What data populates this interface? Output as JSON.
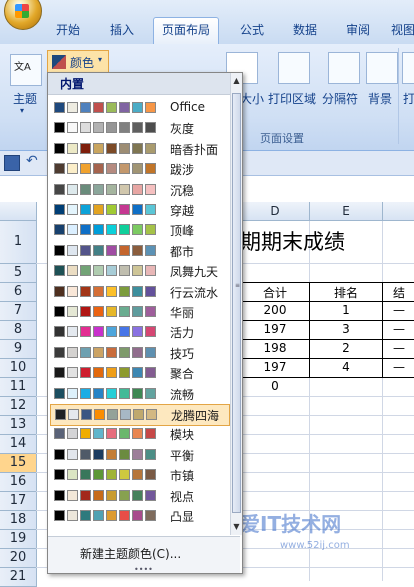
{
  "ribbon_tabs": [
    "开始",
    "插入",
    "页面布局",
    "公式",
    "数据",
    "审阅",
    "视图"
  ],
  "active_tab": "页面布局",
  "ribbon": {
    "theme_label": "主题",
    "colors_label": "颜色",
    "size_label": "大小",
    "print_area_label": "打印区域",
    "breaks_label": "分隔符",
    "background_label": "背景",
    "print_titles_label": "打",
    "group_label": "页面设置"
  },
  "dropdown": {
    "header": "内置",
    "new_theme": "新建主题颜色(C)...",
    "themes": [
      {
        "name": "Office",
        "colors": [
          "#1f497d",
          "#eeece1",
          "#4f81bd",
          "#c0504d",
          "#9bbb59",
          "#8064a2",
          "#4bacc6",
          "#f79646"
        ]
      },
      {
        "name": "灰度",
        "colors": [
          "#000000",
          "#f8f8f8",
          "#dddddd",
          "#b2b2b2",
          "#969696",
          "#808080",
          "#5f5f5f",
          "#4d4d4d"
        ]
      },
      {
        "name": "暗香扑面",
        "colors": [
          "#000000",
          "#ece9c6",
          "#7e1e0b",
          "#c9a55f",
          "#7c4a27",
          "#9d8d74",
          "#7f7652",
          "#a99b6e"
        ]
      },
      {
        "name": "跋涉",
        "colors": [
          "#4e3b30",
          "#fbeec9",
          "#f0a22e",
          "#a5644e",
          "#b58b80",
          "#c3986d",
          "#a19574",
          "#c17529"
        ]
      },
      {
        "name": "沉稳",
        "colors": [
          "#464646",
          "#dde9ec",
          "#6a8c7c",
          "#8ba69b",
          "#a5b59f",
          "#d1c7ad",
          "#e7a6a3",
          "#f5c0c0"
        ]
      },
      {
        "name": "穿越",
        "colors": [
          "#003e75",
          "#e3f4fc",
          "#0da2d8",
          "#e2a321",
          "#a0ca33",
          "#c53891",
          "#0f6fc6",
          "#5bc6d6"
        ]
      },
      {
        "name": "顶峰",
        "colors": [
          "#17406d",
          "#dbefff",
          "#0f6fc6",
          "#009dd9",
          "#0bd0d9",
          "#10cf9b",
          "#7cca62",
          "#a5c249"
        ]
      },
      {
        "name": "都市",
        "colors": [
          "#000000",
          "#dee6ef",
          "#53548a",
          "#438086",
          "#a04da3",
          "#c4652d",
          "#8b5d3d",
          "#5c92b5"
        ]
      },
      {
        "name": "凤舞九天",
        "colors": [
          "#1e5155",
          "#ebddc3",
          "#72a376",
          "#b0ccb0",
          "#a8cdd7",
          "#c0beaf",
          "#cec597",
          "#e8b7b7"
        ]
      },
      {
        "name": "行云流水",
        "colors": [
          "#4e2f1f",
          "#f9e7d8",
          "#a23517",
          "#d46f36",
          "#fcc02a",
          "#7c9c3c",
          "#3d8f9d",
          "#63519b"
        ]
      },
      {
        "name": "华丽",
        "colors": [
          "#000000",
          "#e5e8d5",
          "#b01513",
          "#ea6312",
          "#e6b729",
          "#6aac90",
          "#5f9c9d",
          "#9e5e9b"
        ]
      },
      {
        "name": "活力",
        "colors": [
          "#323232",
          "#e4e9ef",
          "#e32d91",
          "#c830cc",
          "#4ea6dc",
          "#4775e7",
          "#8971e1",
          "#d54773"
        ]
      },
      {
        "name": "技巧",
        "colors": [
          "#3b3b3b",
          "#d4d2d0",
          "#6ea0b0",
          "#cca364",
          "#c96c3c",
          "#7e9a6b",
          "#916d8d",
          "#5e90b0"
        ]
      },
      {
        "name": "聚合",
        "colors": [
          "#1a1a1a",
          "#e2e2e2",
          "#ce1f2f",
          "#e2690c",
          "#ef9e18",
          "#8d9b2d",
          "#3d87b2",
          "#835c91"
        ]
      },
      {
        "name": "流畅",
        "colors": [
          "#1c4e60",
          "#ddf1fb",
          "#1cade4",
          "#2683c6",
          "#27ced7",
          "#42ba97",
          "#3e8853",
          "#62a39f"
        ]
      },
      {
        "name": "龙腾四海",
        "colors": [
          "#1f2123",
          "#e4e9ee",
          "#3a5683",
          "#fa8d00",
          "#93a299",
          "#a7b8c5",
          "#c0a96d",
          "#d3b882"
        ]
      },
      {
        "name": "模块",
        "colors": [
          "#5a6378",
          "#d4d4d6",
          "#f0ad00",
          "#60b5cc",
          "#e66c7d",
          "#6bb76d",
          "#e88651",
          "#c64847"
        ]
      },
      {
        "name": "平衡",
        "colors": [
          "#000000",
          "#e2e6ec",
          "#4f5a68",
          "#1b3b5f",
          "#c47d36",
          "#6b8b3f",
          "#9d7e99",
          "#4c8e86"
        ]
      },
      {
        "name": "市镇",
        "colors": [
          "#000000",
          "#dbe5c3",
          "#38775b",
          "#5d9735",
          "#a0b435",
          "#cec93e",
          "#b6763b",
          "#7a5a45"
        ]
      },
      {
        "name": "视点",
        "colors": [
          "#000000",
          "#f3e8d8",
          "#a3281b",
          "#c76b19",
          "#c99b30",
          "#87a14f",
          "#47815b",
          "#72589b"
        ]
      },
      {
        "name": "凸显",
        "colors": [
          "#000000",
          "#ede7db",
          "#2d7a7d",
          "#50a1b3",
          "#dc9b2f",
          "#e84d47",
          "#a84b8c",
          "#7e6b5c"
        ]
      }
    ]
  },
  "sheet": {
    "columns": [
      "D",
      "E"
    ],
    "rows": [
      "1",
      "5",
      "6",
      "7",
      "8",
      "9",
      "10",
      "11",
      "12",
      "13",
      "14",
      "15",
      "16",
      "17",
      "18",
      "19",
      "20",
      "21"
    ],
    "selected_row": "15",
    "title_fragment": "期期末成绩",
    "table_header": [
      "合计",
      "排名",
      "结"
    ],
    "table_rows": [
      [
        "200",
        "1",
        "—"
      ],
      [
        "197",
        "3",
        "—"
      ],
      [
        "198",
        "2",
        "—"
      ],
      [
        "197",
        "4",
        "—"
      ]
    ],
    "row11_value": "0"
  },
  "watermark": "我爱IT技术网",
  "watermark_url": "www.52ij.com"
}
